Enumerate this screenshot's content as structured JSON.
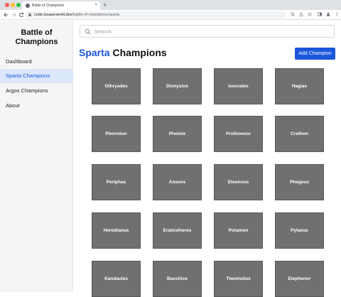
{
  "browser": {
    "tab_title": "Battle of Champions",
    "tab_close": "×",
    "new_tab": "+",
    "url_host": "code.lucaseverett.dev",
    "url_path": "/battle-of-champions/sparta",
    "icons": [
      "back-arrow-icon",
      "forward-arrow-icon",
      "reload-icon",
      "lock-icon",
      "zoom-icon",
      "share-icon",
      "star-icon",
      "sidebar-icon",
      "profile-icon",
      "more-icon"
    ]
  },
  "sidebar": {
    "brand": "Battle of Champions",
    "items": [
      {
        "label": "Dashboard",
        "active": false
      },
      {
        "label": "Sparta Champions",
        "active": true
      },
      {
        "label": "Argos Champions",
        "active": false
      },
      {
        "label": "About",
        "active": false
      }
    ]
  },
  "search": {
    "placeholder": "Search",
    "value": ""
  },
  "header": {
    "city": "Sparta",
    "title_rest": " Champions",
    "add_button": "Add Champion"
  },
  "colors": {
    "accent": "#1a56db",
    "card": "#707070",
    "active_nav_bg": "#dbe7fb"
  },
  "champions": [
    "Othryades",
    "Dionysios",
    "Isocrates",
    "Hagias",
    "Phormion",
    "Phoinix",
    "Prothoenor",
    "Crethon",
    "Periphas",
    "Anaxos",
    "Eteonous",
    "Phegeus",
    "Herodianus",
    "Eratostheres",
    "Potamon",
    "Pylaeus",
    "Kandaules",
    "Bacchios",
    "Themistius",
    "Elephenor"
  ]
}
